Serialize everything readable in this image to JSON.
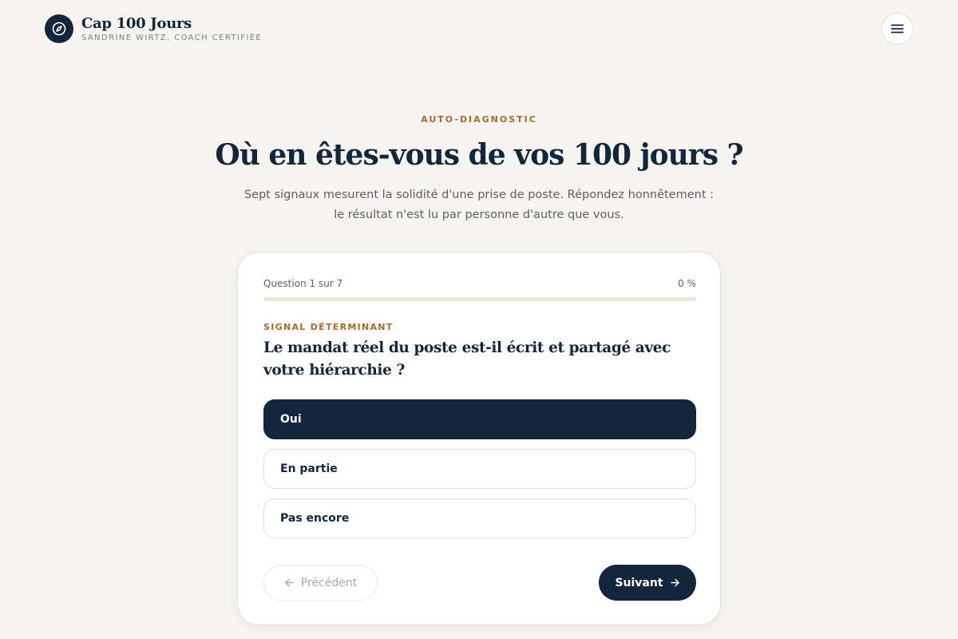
{
  "brand": {
    "title": "Cap 100 Jours",
    "subtitle": "SANDRINE WIRTZ, COACH CERTIFIÉE",
    "logo_icon": "compass-icon"
  },
  "header": {
    "menu_icon": "menu-icon"
  },
  "hero": {
    "eyebrow": "AUTO-DIAGNOSTIC",
    "title": "Où en êtes-vous de vos 100 jours ?",
    "intro": "Sept signaux mesurent la solidité d'une prise de poste. Répondez honnêtement : le résultat n'est lu par personne d'autre que vous."
  },
  "quiz": {
    "progress_label": "Question 1 sur 7",
    "progress_percent_label": "0 %",
    "progress_value": 0,
    "question_kicker": "SIGNAL DÉTERMINANT",
    "question": "Le mandat réel du poste est-il écrit et partagé avec votre hiérarchie ?",
    "options": [
      "Oui",
      "En partie",
      "Pas encore"
    ],
    "selected_option": "Oui",
    "prev_label": "Précédent",
    "next_label": "Suivant",
    "prev_icon": "arrow-left-icon",
    "next_icon": "arrow-right-icon"
  },
  "colors": {
    "navy": "#14263b",
    "accent": "#a86c2c",
    "background": "#f6f4f0"
  }
}
